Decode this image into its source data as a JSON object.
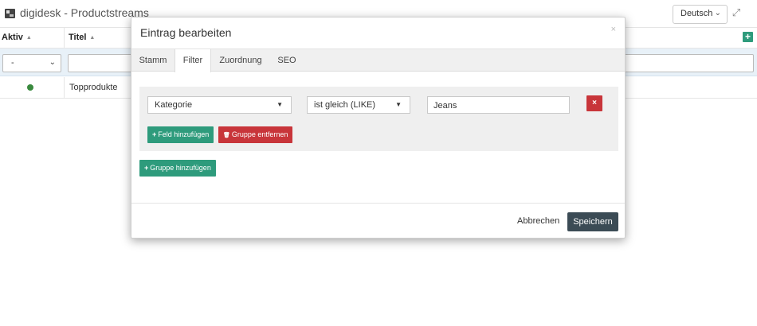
{
  "app": {
    "title": "digidesk - Productstreams",
    "language": "Deutsch"
  },
  "grid": {
    "columns": [
      {
        "label": "Aktiv",
        "sort_icon": "▲"
      },
      {
        "label": "Titel",
        "sort_icon": "▲"
      }
    ],
    "filter": {
      "aktiv_value": "-"
    },
    "rows": [
      {
        "aktiv_color": "#3a8a3e",
        "title": "Topprodukte"
      }
    ],
    "add_icon": "+"
  },
  "modal": {
    "title": "Eintrag bearbeiten",
    "close_icon": "×",
    "tabs": [
      {
        "label": "Stamm",
        "active": false
      },
      {
        "label": "Filter",
        "active": true
      },
      {
        "label": "Zuordnung",
        "active": false
      },
      {
        "label": "SEO",
        "active": false
      }
    ],
    "filter_group": {
      "field": "Kategorie",
      "operator": "ist gleich (LIKE)",
      "value": "Jeans",
      "remove_icon": "×",
      "add_field_icon": "+",
      "add_field_label": "Feld hinzufügen",
      "remove_group_icon": "🗑",
      "remove_group_label": "Gruppe entfernen"
    },
    "add_group_icon": "+",
    "add_group_label": "Gruppe hinzufügen",
    "cancel_label": "Abbrechen",
    "save_label": "Speichern"
  },
  "colors": {
    "accent_green": "#2e9b7c",
    "danger_red": "#c8353a",
    "save_dark": "#3b4b55"
  }
}
